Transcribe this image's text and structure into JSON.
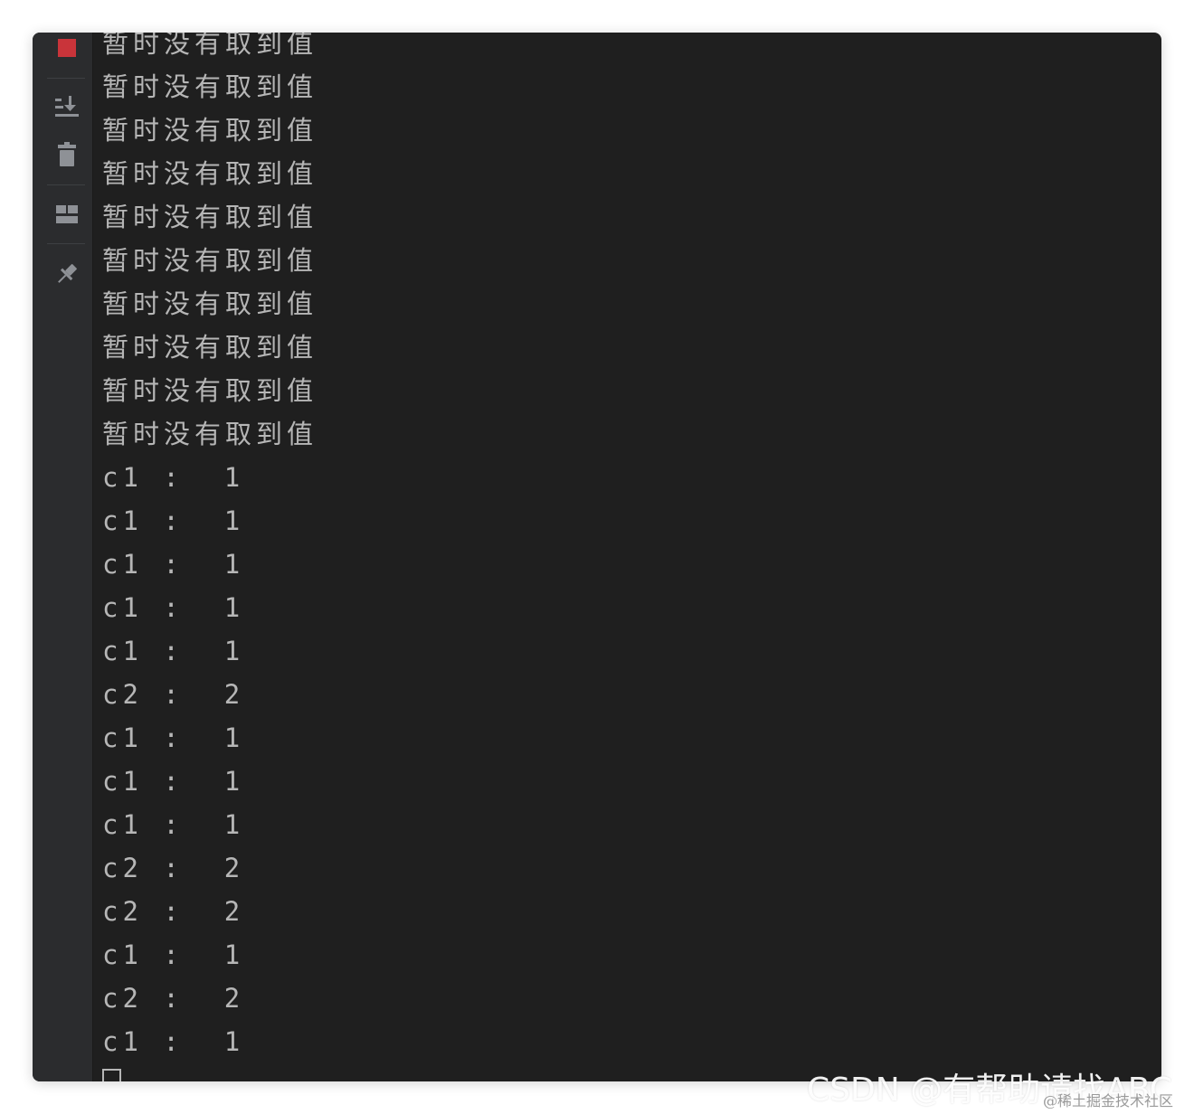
{
  "console": {
    "lines": [
      "暂时没有取到值",
      "暂时没有取到值",
      "暂时没有取到值",
      "暂时没有取到值",
      "暂时没有取到值",
      "暂时没有取到值",
      "暂时没有取到值",
      "暂时没有取到值",
      "暂时没有取到值",
      "暂时没有取到值",
      "c1 :  1",
      "c1 :  1",
      "c1 :  1",
      "c1 :  1",
      "c1 :  1",
      "c2 :  2",
      "c1 :  1",
      "c1 :  1",
      "c1 :  1",
      "c2 :  2",
      "c2 :  2",
      "c1 :  1",
      "c2 :  2",
      "c1 :  1"
    ]
  },
  "toolbar": {
    "icons": [
      "stop-icon",
      "scroll-to-end-icon",
      "trash-icon",
      "layout-icon",
      "pin-icon"
    ],
    "colors": {
      "stop": "#c9343a",
      "icon": "#8e9196"
    }
  },
  "watermark": {
    "main": "CSDN @有帮助请找ABC",
    "sub": "@稀土掘金技术社区"
  }
}
